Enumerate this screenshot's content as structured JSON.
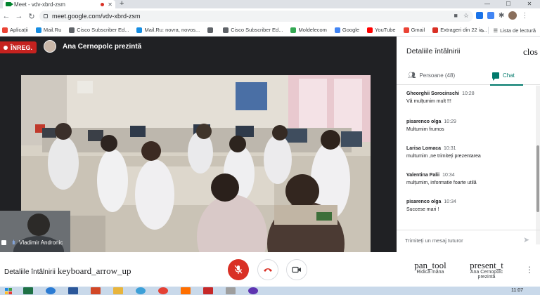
{
  "browser": {
    "tab_title": "Meet - vdv-xbrd-zsm",
    "url": "meet.google.com/vdv-xbrd-zsm"
  },
  "bookmarks": [
    {
      "label": "Aplicații",
      "color": "#ea4335"
    },
    {
      "label": "Mail.Ru",
      "color": "#168de2"
    },
    {
      "label": "Cisco Subscriber Ed...",
      "color": "#5f6368"
    },
    {
      "label": "Mail.Ru: novra, novos...",
      "color": "#168de2"
    },
    {
      "label": "",
      "color": "#5f6368"
    },
    {
      "label": "Cisco Subscriber Ed...",
      "color": "#5f6368"
    },
    {
      "label": "Moldelecom",
      "color": "#34a853"
    },
    {
      "label": "Google",
      "color": "#4285f4"
    },
    {
      "label": "YouTube",
      "color": "#ff0000"
    },
    {
      "label": "Gmail",
      "color": "#ea4335"
    },
    {
      "label": "Extrageri din 22 ia...",
      "color": "#d93025"
    }
  ],
  "reading_list": "Lista de lectură",
  "meeting": {
    "recording_badge": "ÎNREG.",
    "presenter_text": "Ana Cernopolc prezintă",
    "self_name": "Vladimir Andronic"
  },
  "panel": {
    "title": "Detaliile întâlnirii",
    "close": "clos",
    "tab_people": "Persoane (48)",
    "tab_chat": "Chat",
    "messages": [
      {
        "author": "Gheorghii Sorocinschi",
        "time": "10:28",
        "text": "Vă mulțumim mult !!!"
      },
      {
        "author": "pisarenco olga",
        "time": "10:29",
        "text": "Multumim frumos"
      },
      {
        "author": "Larisa Lomaca",
        "time": "10:31",
        "text": "multumim ,ne trimiteți prezentarea"
      },
      {
        "author": "Valentina Palii",
        "time": "10:34",
        "text": "mulțumim, informatie  foarte utilă"
      },
      {
        "author": "pisarenco olga",
        "time": "10:34",
        "text": "Succese mari !"
      }
    ],
    "input_placeholder": "Trimiteți un mesaj tuturor"
  },
  "controls": {
    "details_label": "Detaliile întâlnirii",
    "details_icon": "keyboard_arrow_up",
    "raise_icon": "pan_tool",
    "raise_label": "Ridică mâna",
    "present_icon": "present_t",
    "present_label": "Ana Cernopolc prezintă"
  },
  "taskbar": {
    "clock": "11:07"
  },
  "colors": {
    "record_red": "#c5221f",
    "hangup_red": "#d93025",
    "chat_teal": "#00796b"
  }
}
